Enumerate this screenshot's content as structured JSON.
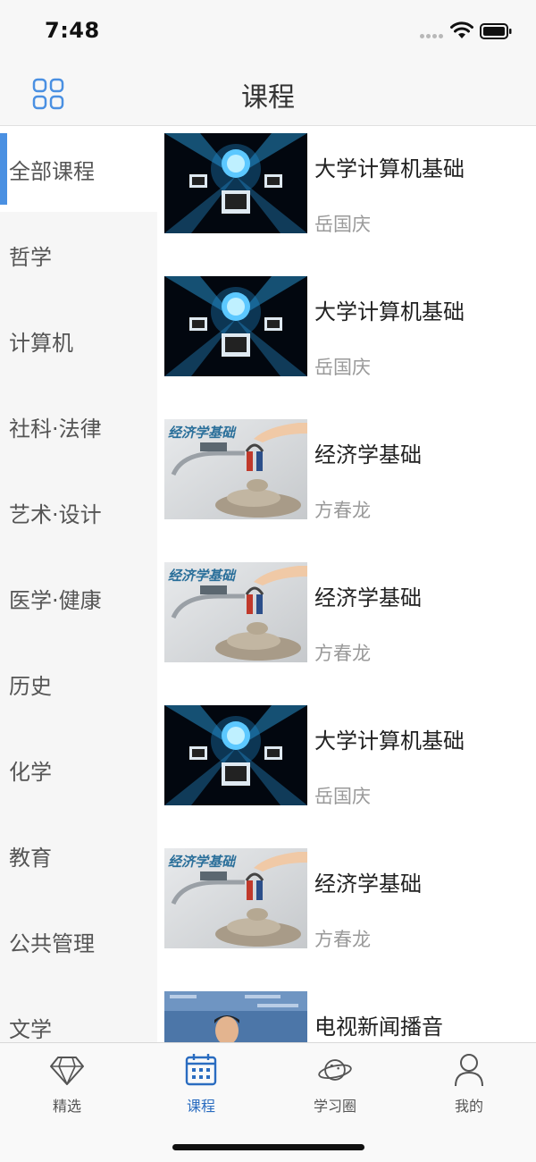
{
  "status_bar": {
    "time": "7:48"
  },
  "nav": {
    "title": "课程",
    "menu_icon": "grid-icon"
  },
  "colors": {
    "accent": "#4a90e2",
    "tab_active": "#2a6cc0",
    "sidebar_bg": "#f6f6f6"
  },
  "sidebar": {
    "active_index": 0,
    "items": [
      {
        "label": "全部课程"
      },
      {
        "label": "哲学"
      },
      {
        "label": "计算机"
      },
      {
        "label": "社科·法律"
      },
      {
        "label": "艺术·设计"
      },
      {
        "label": "医学·健康"
      },
      {
        "label": "历史"
      },
      {
        "label": "化学"
      },
      {
        "label": "教育"
      },
      {
        "label": "公共管理"
      },
      {
        "label": "文学"
      }
    ]
  },
  "courses": [
    {
      "title": "大学计算机基础",
      "teacher": "岳国庆",
      "thumb": "network-computers"
    },
    {
      "title": "大学计算机基础",
      "teacher": "岳国庆",
      "thumb": "network-computers"
    },
    {
      "title": "经济学基础",
      "teacher": "方春龙",
      "thumb": "economics-magnet",
      "thumb_text": "经济学基础"
    },
    {
      "title": "经济学基础",
      "teacher": "方春龙",
      "thumb": "economics-magnet",
      "thumb_text": "经济学基础"
    },
    {
      "title": "大学计算机基础",
      "teacher": "岳国庆",
      "thumb": "network-computers"
    },
    {
      "title": "经济学基础",
      "teacher": "方春龙",
      "thumb": "economics-magnet",
      "thumb_text": "经济学基础"
    },
    {
      "title": "电视新闻播音",
      "teacher": "",
      "thumb": "news-anchor"
    }
  ],
  "tabs": [
    {
      "label": "精选",
      "icon": "diamond-icon",
      "active": false
    },
    {
      "label": "课程",
      "icon": "calendar-icon",
      "active": true
    },
    {
      "label": "学习圈",
      "icon": "planet-icon",
      "active": false
    },
    {
      "label": "我的",
      "icon": "user-icon",
      "active": false
    }
  ]
}
